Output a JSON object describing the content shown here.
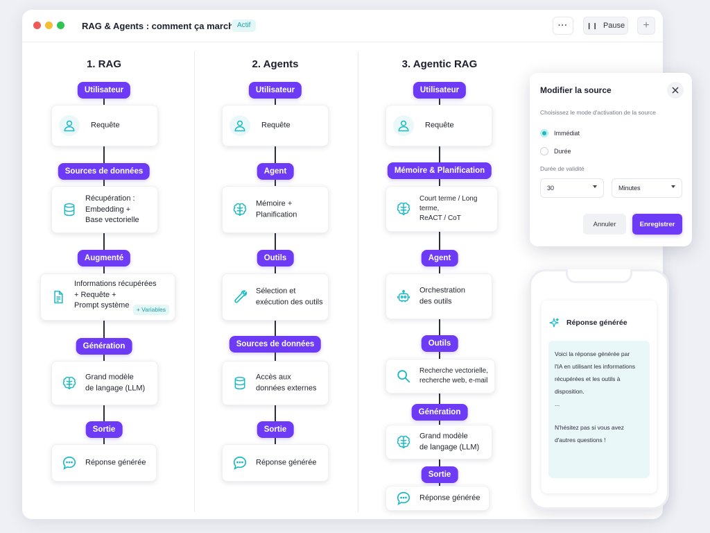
{
  "window": {
    "title": "RAG & Agents : comment ça marche",
    "status_badge": "Actif",
    "more_label": "···",
    "pause_label": "Pause",
    "add_label": "+"
  },
  "columns": [
    {
      "title": "1. RAG",
      "steps": [
        {
          "pill": "Utilisateur",
          "card": "Requête",
          "icon": "user-icon"
        },
        {
          "pill": "Sources de données",
          "card": "Récupération :\nEmbedding +\nBase vectorielle",
          "icon": "database-icon"
        },
        {
          "pill": "Augmenté",
          "card": "Informations récupérées\n+ Requête +\nPrompt système",
          "icon": "document-icon",
          "badge": "+ Variables"
        },
        {
          "pill": "Génération",
          "card": "Grand modèle\nde langage (LLM)",
          "icon": "brain-icon"
        },
        {
          "pill": "Sortie",
          "card": "Réponse générée",
          "icon": "chat-icon"
        }
      ]
    },
    {
      "title": "2. Agents",
      "steps": [
        {
          "pill": "Utilisateur",
          "card": "Requête",
          "icon": "user-icon"
        },
        {
          "pill": "Agent",
          "card": "Mémoire +\nPlanification",
          "icon": "brain-icon"
        },
        {
          "pill": "Outils",
          "card": "Sélection et\nexécution des outils",
          "icon": "wrench-icon"
        },
        {
          "pill": "Sources de données",
          "card": "Accès aux\ndonnées externes",
          "icon": "database-icon"
        },
        {
          "pill": "Sortie",
          "card": "Réponse générée",
          "icon": "chat-icon"
        }
      ]
    },
    {
      "title": "3. Agentic RAG",
      "steps": [
        {
          "pill": "Utilisateur",
          "card": "Requête",
          "icon": "user-icon"
        },
        {
          "pill": "Mémoire & Planification",
          "card": "Court terme / Long terme,\nReACT / CoT",
          "icon": "brain-icon"
        },
        {
          "pill": "Agent",
          "card": "Orchestration\ndes outils",
          "icon": "robot-icon"
        },
        {
          "pill": "Outils",
          "card": "Recherche vectorielle,\nrecherche web, e-mail",
          "icon": "search-icon"
        },
        {
          "pill": "Génération",
          "card": "Grand modèle\nde langage (LLM)",
          "icon": "brain-icon"
        },
        {
          "pill": "Sortie",
          "card": "Réponse générée",
          "icon": "chat-icon"
        }
      ]
    }
  ],
  "modal": {
    "title": "Modifier la source",
    "subtitle": "Choisissez le mode d'activation de la source",
    "options": [
      {
        "label": "Immédiat",
        "selected": true
      },
      {
        "label": "Durée",
        "selected": false
      }
    ],
    "validity_label": "Durée de validité",
    "duration_value": "30",
    "unit_value": "Minutes",
    "cancel_label": "Annuler",
    "save_label": "Enregistrer"
  },
  "phone": {
    "header": "Réponse générée",
    "body_lines": [
      "Voici la réponse générée par",
      "l'IA en utilisant les informations",
      "récupérées et les outils à",
      "disposition.",
      "..."
    ],
    "footer_lines": [
      "N'hésitez pas si vous avez",
      "d'autres questions !"
    ]
  },
  "colors": {
    "accent": "#6d3bf5",
    "icon_teal": "#1ab9c2",
    "badge_bg": "#e3f7f7"
  }
}
